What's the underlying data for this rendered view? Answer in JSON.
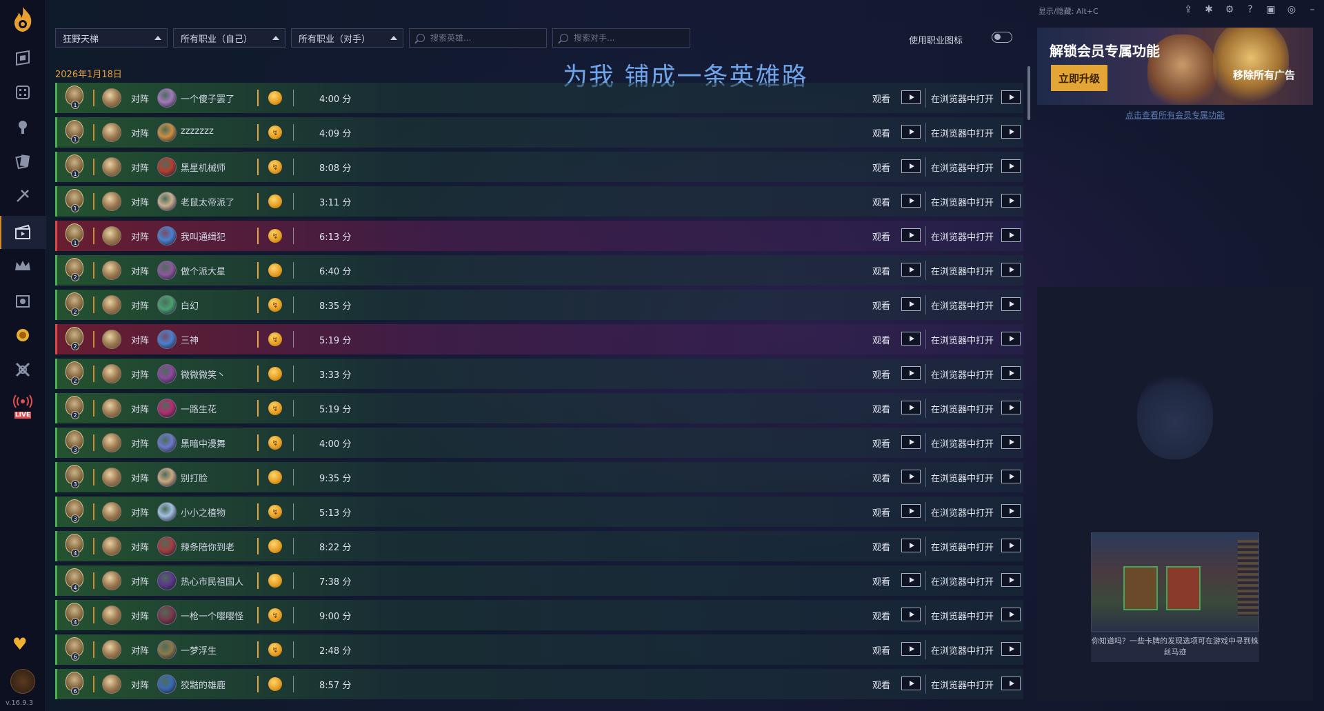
{
  "sidebar": {
    "version": "v.16.9.3",
    "items": [
      "app-logo",
      "decks-icon",
      "stats-icon",
      "battlegrounds-icon",
      "cards-icon",
      "arena-icon",
      "replays-icon",
      "crown-icon",
      "calendar-icon",
      "mercenaries-icon",
      "duels-icon",
      "live-icon"
    ],
    "live_label": "LIVE"
  },
  "topbar": {
    "hint": "显示/隐藏: Alt+C",
    "icons": [
      "share-icon",
      "bug-icon",
      "gear-icon",
      "help-icon",
      "discord-icon",
      "globe-icon",
      "minimize-icon",
      "restore-icon",
      "close-icon"
    ]
  },
  "filters": {
    "mode": "狂野天梯",
    "own_class": "所有职业（自己）",
    "opp_class": "所有职业（对手）",
    "search_hero_placeholder": "搜索英雄...",
    "search_opp_placeholder": "搜索对手...",
    "toggle_label": "使用职业图标"
  },
  "date": "2026年1月18日",
  "banner": "为我 铺成一条英雄路",
  "actions": {
    "watch": "观看",
    "browser": "在浏览器中打开",
    "vs": "对阵"
  },
  "games": [
    {
      "rank": "1",
      "opponent": "一个傻子罢了",
      "coin": "first",
      "duration": "4:00 分",
      "result": "win",
      "color": "#a07ab8"
    },
    {
      "rank": "1",
      "opponent": "zzzzzzz",
      "coin": "second",
      "duration": "4:09 分",
      "result": "win",
      "color": "#c89040"
    },
    {
      "rank": "1",
      "opponent": "黑星机械师",
      "coin": "second",
      "duration": "8:08 分",
      "result": "win",
      "color": "#b04030"
    },
    {
      "rank": "1",
      "opponent": "老鼠太帝派了",
      "coin": "first",
      "duration": "3:11 分",
      "result": "win",
      "color": "#c8b090"
    },
    {
      "rank": "1",
      "opponent": "我叫通缉犯",
      "coin": "second",
      "duration": "6:13 分",
      "result": "loss",
      "color": "#4a80d0"
    },
    {
      "rank": "2",
      "opponent": "做个派大星",
      "coin": "first",
      "duration": "6:40 分",
      "result": "win",
      "color": "#8a5a9a"
    },
    {
      "rank": "2",
      "opponent": "白幻",
      "coin": "second",
      "duration": "8:35 分",
      "result": "win",
      "color": "#4aa070"
    },
    {
      "rank": "2",
      "opponent": "三神",
      "coin": "second",
      "duration": "5:19 分",
      "result": "loss",
      "color": "#4a80d0"
    },
    {
      "rank": "2",
      "opponent": "微微微笑丶",
      "coin": "first",
      "duration": "3:33 分",
      "result": "win",
      "color": "#8a4a9a"
    },
    {
      "rank": "2",
      "opponent": "一路生花",
      "coin": "second",
      "duration": "5:19 分",
      "result": "win",
      "color": "#b03070"
    },
    {
      "rank": "3",
      "opponent": "黑暗中漫舞",
      "coin": "second",
      "duration": "4:00 分",
      "result": "win",
      "color": "#6a7ac8"
    },
    {
      "rank": "3",
      "opponent": "别打脸",
      "coin": "first",
      "duration": "9:35 分",
      "result": "win",
      "color": "#c8a880"
    },
    {
      "rank": "3",
      "opponent": "小小之植物",
      "coin": "second",
      "duration": "5:13 分",
      "result": "win",
      "color": "#a0c0e0"
    },
    {
      "rank": "4",
      "opponent": "辣条陪你到老",
      "coin": "first",
      "duration": "8:22 分",
      "result": "win",
      "color": "#a04040"
    },
    {
      "rank": "4",
      "opponent": "热心市民祖国人",
      "coin": "first",
      "duration": "7:38 分",
      "result": "win",
      "color": "#5a3a8a"
    },
    {
      "rank": "4",
      "opponent": "一枪一个嘤嘤怪",
      "coin": "second",
      "duration": "9:00 分",
      "result": "win",
      "color": "#7a3a4a"
    },
    {
      "rank": "6",
      "opponent": "一梦浮生",
      "coin": "second",
      "duration": "2:48 分",
      "result": "win",
      "color": "#8a7a4a"
    },
    {
      "rank": "6",
      "opponent": "狡黠的雄鹿",
      "coin": "first",
      "duration": "8:57 分",
      "result": "win",
      "color": "#3a6ab0"
    }
  ],
  "ad": {
    "title": "解锁会员专属功能",
    "upgrade": "立即升级",
    "remove_ads": "移除所有广告",
    "link": "点击查看所有会员专属功能"
  },
  "tip": {
    "text": "你知道吗？一些卡牌的发现选项可在游戏中寻到蛛丝马迹"
  }
}
